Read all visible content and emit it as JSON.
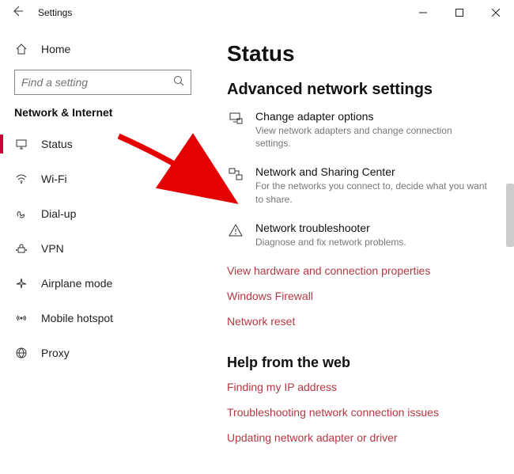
{
  "window": {
    "title": "Settings"
  },
  "home_label": "Home",
  "search": {
    "placeholder": "Find a setting"
  },
  "category": "Network & Internet",
  "nav": [
    {
      "label": "Status",
      "icon": "status-icon",
      "active": true
    },
    {
      "label": "Wi-Fi",
      "icon": "wifi-icon"
    },
    {
      "label": "Dial-up",
      "icon": "dialup-icon"
    },
    {
      "label": "VPN",
      "icon": "vpn-icon"
    },
    {
      "label": "Airplane mode",
      "icon": "airplane-icon"
    },
    {
      "label": "Mobile hotspot",
      "icon": "hotspot-icon"
    },
    {
      "label": "Proxy",
      "icon": "proxy-icon"
    }
  ],
  "page": {
    "title": "Status",
    "section": "Advanced network settings",
    "options": [
      {
        "title": "Change adapter options",
        "desc": "View network adapters and change connection settings.",
        "icon": "adapter-icon"
      },
      {
        "title": "Network and Sharing Center",
        "desc": "For the networks you connect to, decide what you want to share.",
        "icon": "sharing-icon"
      },
      {
        "title": "Network troubleshooter",
        "desc": "Diagnose and fix network problems.",
        "icon": "warning-icon"
      }
    ],
    "links": [
      "View hardware and connection properties",
      "Windows Firewall",
      "Network reset"
    ],
    "help_heading": "Help from the web",
    "help_links": [
      "Finding my IP address",
      "Troubleshooting network connection issues",
      "Updating network adapter or driver"
    ]
  }
}
